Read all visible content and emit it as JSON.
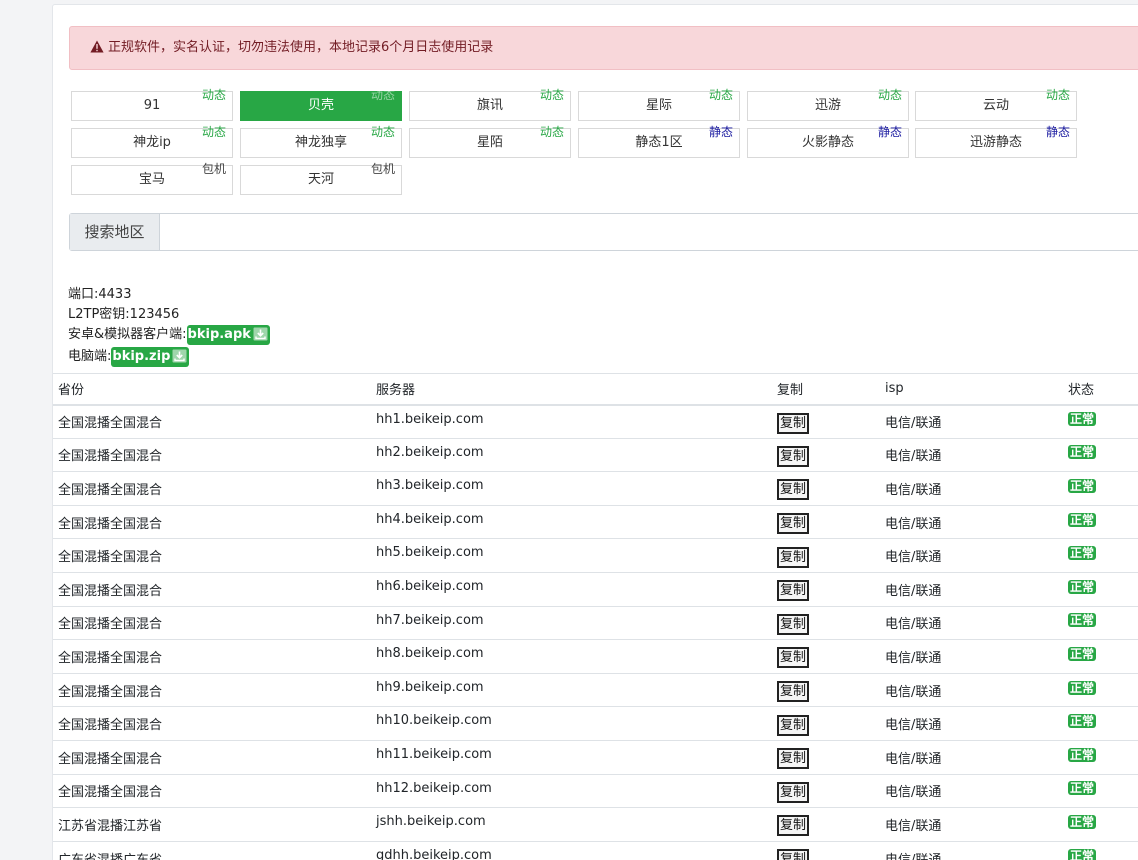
{
  "alert": {
    "text": "正规软件，实名认证，切勿违法使用，本地记录6个月日志使用记录"
  },
  "lines": [
    {
      "name": "91",
      "tag": "动态",
      "tag_type": "dynamic",
      "active": false
    },
    {
      "name": "贝壳",
      "tag": "动态",
      "tag_type": "dynamic",
      "active": true
    },
    {
      "name": "旗讯",
      "tag": "动态",
      "tag_type": "dynamic",
      "active": false
    },
    {
      "name": "星际",
      "tag": "动态",
      "tag_type": "dynamic",
      "active": false
    },
    {
      "name": "迅游",
      "tag": "动态",
      "tag_type": "dynamic",
      "active": false
    },
    {
      "name": "云动",
      "tag": "动态",
      "tag_type": "dynamic",
      "active": false
    },
    {
      "name": "神龙ip",
      "tag": "动态",
      "tag_type": "dynamic",
      "active": false
    },
    {
      "name": "神龙独享",
      "tag": "动态",
      "tag_type": "dynamic",
      "active": false
    },
    {
      "name": "星陌",
      "tag": "动态",
      "tag_type": "dynamic",
      "active": false
    },
    {
      "name": "静态1区",
      "tag": "静态",
      "tag_type": "static",
      "active": false
    },
    {
      "name": "火影静态",
      "tag": "静态",
      "tag_type": "static",
      "active": false
    },
    {
      "name": "迅游静态",
      "tag": "静态",
      "tag_type": "static",
      "active": false
    },
    {
      "name": "宝马",
      "tag": "包机",
      "tag_type": "pkg",
      "active": false
    },
    {
      "name": "天河",
      "tag": "包机",
      "tag_type": "pkg",
      "active": false
    }
  ],
  "search": {
    "label": "搜索地区",
    "value": ""
  },
  "info": {
    "port": "端口:4433",
    "l2tp": "L2TP密钥:123456",
    "android_label": "安卓&模拟器客户端:",
    "android_file": "bkip.apk",
    "pc_label": "电脑端:",
    "pc_file": "bkip.zip"
  },
  "table": {
    "headers": [
      "省份",
      "服务器",
      "复制",
      "isp",
      "状态"
    ],
    "copy_label": "复制",
    "rows": [
      {
        "province": "全国混播全国混合",
        "server": "hh1.beikeip.com",
        "isp": "电信/联通",
        "status": "正常"
      },
      {
        "province": "全国混播全国混合",
        "server": "hh2.beikeip.com",
        "isp": "电信/联通",
        "status": "正常"
      },
      {
        "province": "全国混播全国混合",
        "server": "hh3.beikeip.com",
        "isp": "电信/联通",
        "status": "正常"
      },
      {
        "province": "全国混播全国混合",
        "server": "hh4.beikeip.com",
        "isp": "电信/联通",
        "status": "正常"
      },
      {
        "province": "全国混播全国混合",
        "server": "hh5.beikeip.com",
        "isp": "电信/联通",
        "status": "正常"
      },
      {
        "province": "全国混播全国混合",
        "server": "hh6.beikeip.com",
        "isp": "电信/联通",
        "status": "正常"
      },
      {
        "province": "全国混播全国混合",
        "server": "hh7.beikeip.com",
        "isp": "电信/联通",
        "status": "正常"
      },
      {
        "province": "全国混播全国混合",
        "server": "hh8.beikeip.com",
        "isp": "电信/联通",
        "status": "正常"
      },
      {
        "province": "全国混播全国混合",
        "server": "hh9.beikeip.com",
        "isp": "电信/联通",
        "status": "正常"
      },
      {
        "province": "全国混播全国混合",
        "server": "hh10.beikeip.com",
        "isp": "电信/联通",
        "status": "正常"
      },
      {
        "province": "全国混播全国混合",
        "server": "hh11.beikeip.com",
        "isp": "电信/联通",
        "status": "正常"
      },
      {
        "province": "全国混播全国混合",
        "server": "hh12.beikeip.com",
        "isp": "电信/联通",
        "status": "正常"
      },
      {
        "province": "江苏省混播江苏省",
        "server": "jshh.beikeip.com",
        "isp": "电信/联通",
        "status": "正常"
      },
      {
        "province": "广东省混播广东省",
        "server": "gdhh.beikeip.com",
        "isp": "电信/联通",
        "status": "正常"
      }
    ]
  },
  "colors": {
    "accent": "#28a745",
    "alert_bg": "#f8d7da",
    "alert_text": "#721c24",
    "static_tag": "#1a1aa0"
  },
  "icons": {
    "alert": "warning-triangle-icon",
    "download": "download-icon"
  }
}
